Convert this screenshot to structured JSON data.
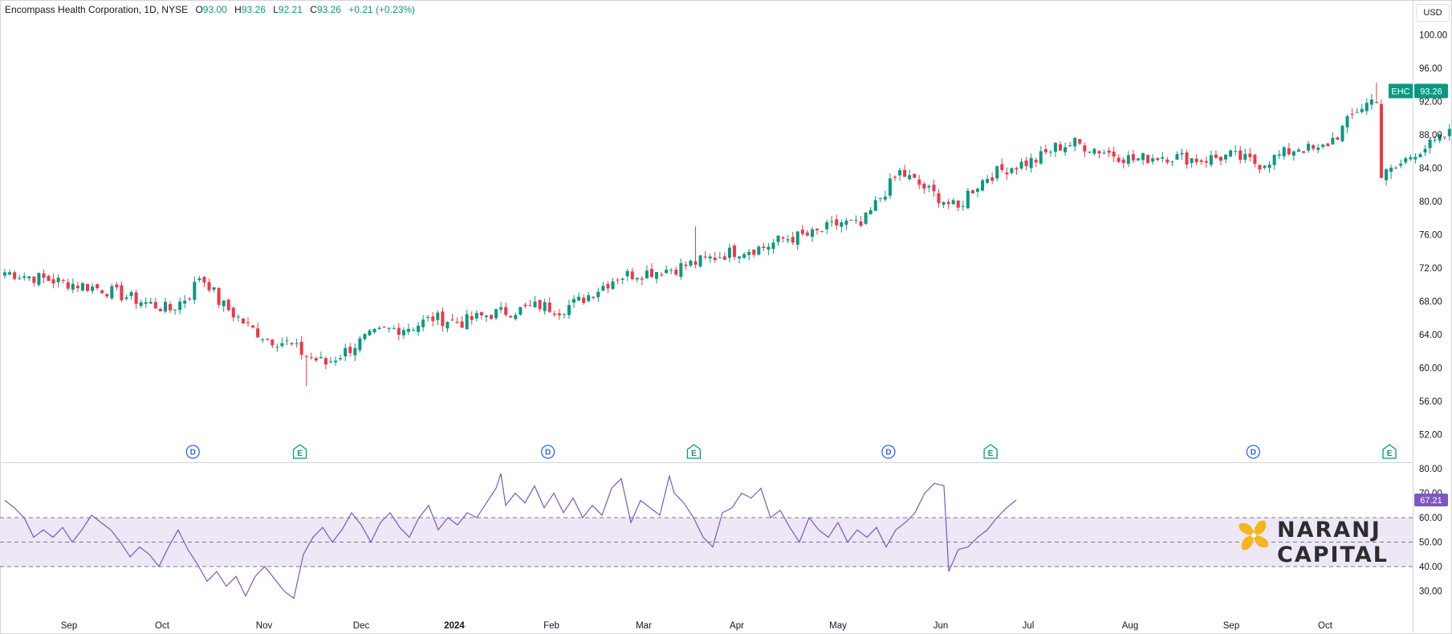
{
  "header": {
    "symbol_name": "Encompass Health Corporation, 1D, NYSE",
    "open_label": "O",
    "open": "93.00",
    "high_label": "H",
    "high": "93.26",
    "low_label": "L",
    "low": "92.21",
    "close_label": "C",
    "close": "93.26",
    "change": "+0.21 (+0.23%)"
  },
  "currency": "USD",
  "price_tag": {
    "ticker": "EHC",
    "value": "93.26"
  },
  "rsi_tag": "67.21",
  "logo": {
    "line1": "NARANJ",
    "line2": "CAPITAL"
  },
  "colors": {
    "up": "#089981",
    "down": "#F23645",
    "rsi": "#7E57C2",
    "rsi_band": "#EDE7F6",
    "dividend": "#2962FF",
    "earnings": "#089981",
    "split": "#9C27B0",
    "future_event": "#E040FB"
  },
  "chart_data": [
    {
      "type": "candlestick",
      "title": "Encompass Health Corporation, 1D, NYSE",
      "x_ticks": [
        "Sep",
        "Oct",
        "Nov",
        "Dec",
        "2024",
        "Feb",
        "Mar",
        "Apr",
        "May",
        "Jun",
        "Jul",
        "Aug",
        "Sep",
        "Oct"
      ],
      "y_ticks": [
        "100.00",
        "96.00",
        "92.00",
        "88.00",
        "84.00",
        "80.00",
        "76.00",
        "72.00",
        "68.00",
        "64.00",
        "60.00",
        "56.00",
        "52.00"
      ],
      "ylim": [
        50.5,
        102
      ],
      "close_path": [
        [
          0,
          71.5
        ],
        [
          10,
          70.5
        ],
        [
          20,
          69.5
        ],
        [
          28,
          68.0
        ],
        [
          34,
          67.0
        ],
        [
          38,
          68.8
        ],
        [
          40,
          71.0
        ],
        [
          42,
          70.0
        ],
        [
          44,
          68.0
        ],
        [
          46,
          67.0
        ],
        [
          50,
          65.0
        ],
        [
          54,
          63.5
        ],
        [
          58,
          63.0
        ],
        [
          62,
          61.5
        ],
        [
          66,
          60.5
        ],
        [
          70,
          62.0
        ],
        [
          74,
          63.5
        ],
        [
          78,
          64.5
        ],
        [
          84,
          65.0
        ],
        [
          88,
          66.0
        ],
        [
          94,
          65.5
        ],
        [
          100,
          66.5
        ],
        [
          106,
          67.0
        ],
        [
          110,
          67.5
        ],
        [
          114,
          67.0
        ],
        [
          118,
          68.0
        ],
        [
          122,
          69.5
        ],
        [
          126,
          71.0
        ],
        [
          132,
          71.5
        ],
        [
          138,
          72.0
        ],
        [
          144,
          73.0
        ],
        [
          150,
          74.0
        ],
        [
          156,
          74.5
        ],
        [
          160,
          75.5
        ],
        [
          166,
          76.0
        ],
        [
          172,
          77.5
        ],
        [
          176,
          77.0
        ],
        [
          180,
          80.5
        ],
        [
          184,
          83.5
        ],
        [
          188,
          82.0
        ],
        [
          192,
          80.5
        ],
        [
          196,
          79.0
        ],
        [
          198,
          81.0
        ],
        [
          202,
          83.0
        ],
        [
          206,
          84.0
        ],
        [
          212,
          85.0
        ],
        [
          216,
          86.5
        ],
        [
          220,
          87.0
        ],
        [
          226,
          86.0
        ],
        [
          232,
          85.0
        ],
        [
          238,
          85.5
        ],
        [
          246,
          85.0
        ],
        [
          252,
          85.5
        ],
        [
          258,
          84.5
        ],
        [
          262,
          85.5
        ],
        [
          266,
          86.5
        ],
        [
          270,
          86.0
        ],
        [
          274,
          88.0
        ],
        [
          278,
          91.0
        ],
        [
          282,
          92.5
        ],
        [
          283,
          83.0
        ],
        [
          286,
          84.0
        ],
        [
          290,
          86.0
        ],
        [
          294,
          87.0
        ],
        [
          298,
          88.5
        ],
        [
          302,
          90.0
        ],
        [
          306,
          91.5
        ],
        [
          308,
          93.26
        ]
      ],
      "wicks": [
        {
          "day": 62,
          "low": 57.8
        },
        {
          "day": 142,
          "high": 77.0
        },
        {
          "day": 282,
          "high": 94.3
        },
        {
          "day": 285,
          "low": 82.7
        }
      ],
      "events": [
        {
          "type": "dividend",
          "label": "D",
          "day": 38
        },
        {
          "type": "earnings",
          "label": "E",
          "day": 60
        },
        {
          "type": "dividend",
          "label": "D",
          "day": 111
        },
        {
          "type": "earnings",
          "label": "E",
          "day": 141
        },
        {
          "type": "dividend",
          "label": "D",
          "day": 181
        },
        {
          "type": "earnings",
          "label": "E",
          "day": 202
        },
        {
          "type": "dividend",
          "label": "D",
          "day": 256
        },
        {
          "type": "earnings",
          "label": "E",
          "day": 284
        },
        {
          "type": "split",
          "label": "",
          "day": 307
        },
        {
          "type": "dividend",
          "label": "D",
          "day": 331
        },
        {
          "type": "earnings_future",
          "label": "E",
          "day": 350
        }
      ]
    },
    {
      "type": "line",
      "title": "RSI",
      "series_name": "RSI",
      "y_ticks": [
        "80.00",
        "70.00",
        "60.00",
        "50.00",
        "40.00",
        "30.00"
      ],
      "ylim": [
        25,
        81
      ],
      "band": [
        40,
        60
      ],
      "midline": 50,
      "values": [
        [
          0,
          67
        ],
        [
          4,
          64
        ],
        [
          8,
          60
        ],
        [
          12,
          52
        ],
        [
          16,
          55
        ],
        [
          20,
          52
        ],
        [
          24,
          56
        ],
        [
          28,
          50
        ],
        [
          32,
          55
        ],
        [
          36,
          61
        ],
        [
          40,
          58
        ],
        [
          44,
          55
        ],
        [
          48,
          50
        ],
        [
          52,
          44
        ],
        [
          56,
          48
        ],
        [
          60,
          45
        ],
        [
          64,
          40
        ],
        [
          68,
          48
        ],
        [
          72,
          55
        ],
        [
          76,
          47
        ],
        [
          80,
          41
        ],
        [
          84,
          34
        ],
        [
          88,
          38
        ],
        [
          92,
          32
        ],
        [
          96,
          36
        ],
        [
          100,
          28
        ],
        [
          104,
          36
        ],
        [
          108,
          40
        ],
        [
          112,
          35
        ],
        [
          116,
          30
        ],
        [
          120,
          27
        ],
        [
          124,
          45
        ],
        [
          128,
          52
        ],
        [
          132,
          56
        ],
        [
          136,
          50
        ],
        [
          140,
          55
        ],
        [
          144,
          62
        ],
        [
          148,
          57
        ],
        [
          152,
          50
        ],
        [
          156,
          58
        ],
        [
          160,
          62
        ],
        [
          164,
          56
        ],
        [
          168,
          52
        ],
        [
          172,
          60
        ],
        [
          176,
          65
        ],
        [
          180,
          55
        ],
        [
          184,
          60
        ],
        [
          188,
          57
        ],
        [
          192,
          62
        ],
        [
          196,
          60
        ],
        [
          200,
          66
        ],
        [
          204,
          72
        ],
        [
          206,
          78
        ],
        [
          208,
          65
        ],
        [
          212,
          70
        ],
        [
          216,
          66
        ],
        [
          220,
          73
        ],
        [
          224,
          64
        ],
        [
          228,
          70
        ],
        [
          232,
          62
        ],
        [
          236,
          68
        ],
        [
          240,
          60
        ],
        [
          244,
          65
        ],
        [
          248,
          61
        ],
        [
          252,
          72
        ],
        [
          256,
          76
        ],
        [
          260,
          58
        ],
        [
          264,
          67
        ],
        [
          268,
          64
        ],
        [
          272,
          61
        ],
        [
          276,
          77
        ],
        [
          278,
          70
        ],
        [
          282,
          66
        ],
        [
          286,
          60
        ],
        [
          290,
          52
        ],
        [
          294,
          48
        ],
        [
          298,
          62
        ],
        [
          302,
          64
        ],
        [
          306,
          70
        ],
        [
          310,
          68
        ],
        [
          314,
          72
        ],
        [
          318,
          60
        ],
        [
          322,
          63
        ],
        [
          326,
          56
        ],
        [
          330,
          50
        ],
        [
          334,
          60
        ],
        [
          338,
          55
        ],
        [
          342,
          52
        ],
        [
          346,
          58
        ],
        [
          350,
          50
        ],
        [
          354,
          55
        ],
        [
          358,
          52
        ],
        [
          362,
          56
        ],
        [
          366,
          48
        ],
        [
          370,
          55
        ],
        [
          374,
          58
        ],
        [
          378,
          62
        ],
        [
          382,
          70
        ],
        [
          386,
          74
        ],
        [
          390,
          73
        ],
        [
          392,
          38
        ],
        [
          396,
          47
        ],
        [
          400,
          48
        ],
        [
          404,
          52
        ],
        [
          408,
          55
        ],
        [
          412,
          60
        ],
        [
          416,
          64
        ],
        [
          420,
          67.21
        ]
      ]
    }
  ]
}
